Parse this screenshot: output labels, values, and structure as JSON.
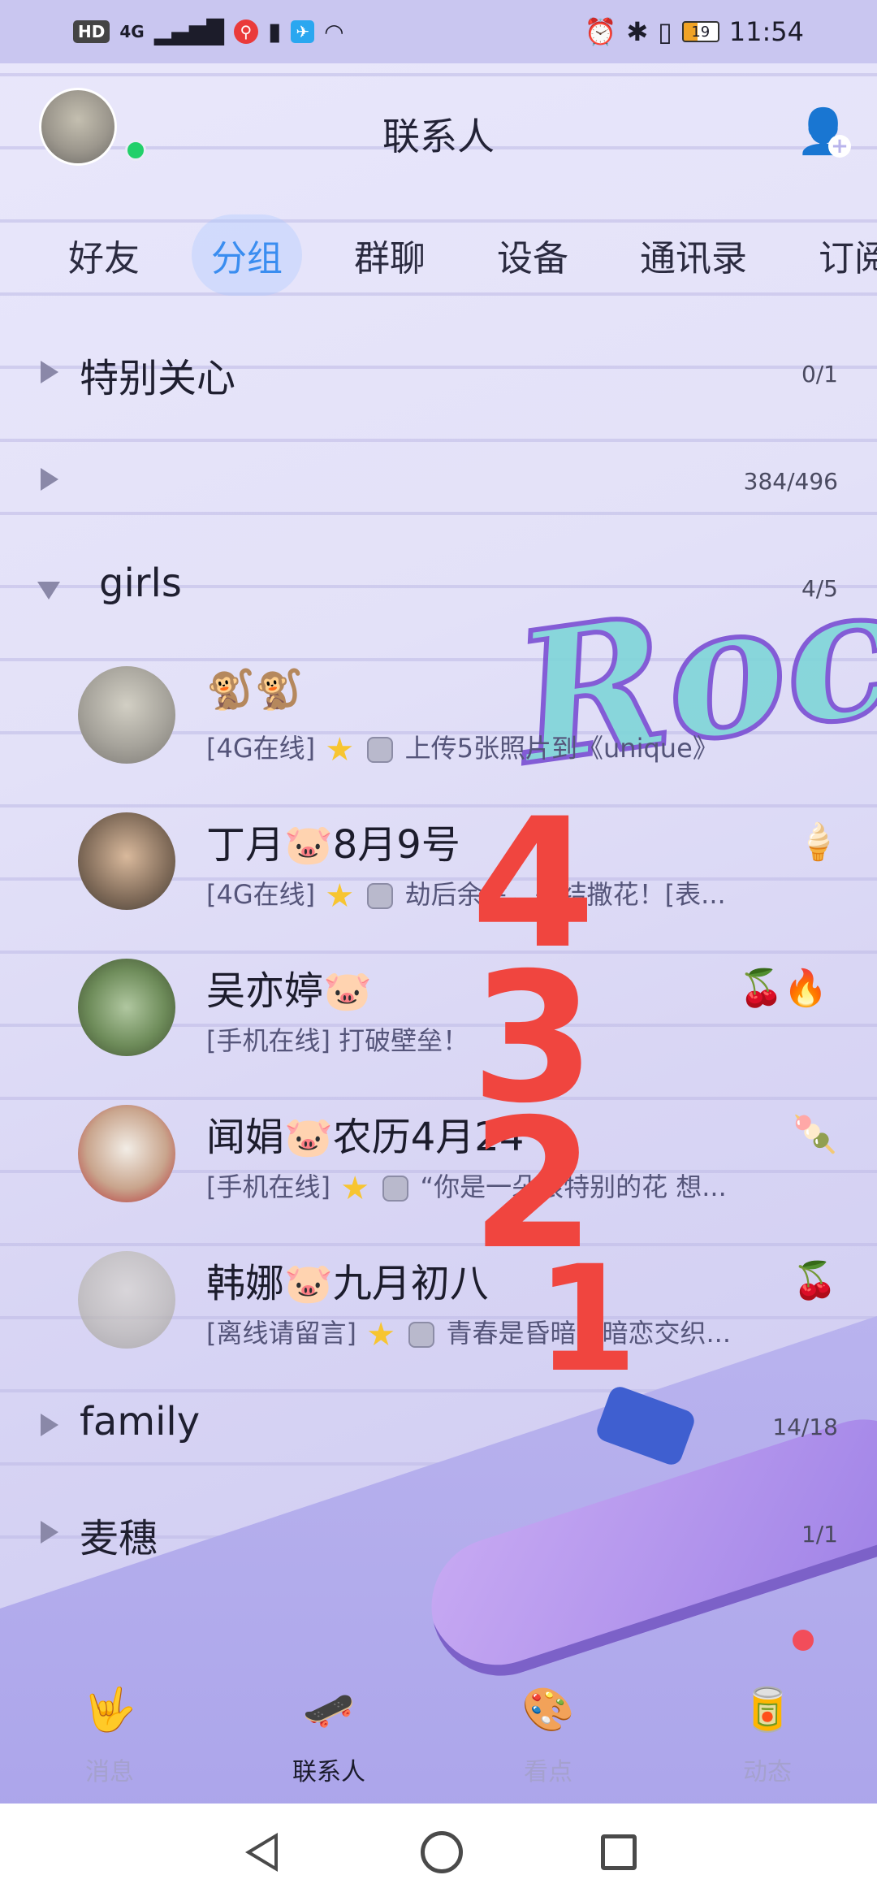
{
  "status_bar": {
    "hd": "HD",
    "network": "4G",
    "battery_level": "19",
    "time": "11:54"
  },
  "header": {
    "title": "联系人"
  },
  "tabs": [
    {
      "label": "好友",
      "active": false
    },
    {
      "label": "分组",
      "active": true
    },
    {
      "label": "群聊",
      "active": false
    },
    {
      "label": "设备",
      "active": false
    },
    {
      "label": "通讯录",
      "active": false
    },
    {
      "label": "订阅",
      "active": false
    }
  ],
  "groups": {
    "special": {
      "name": "特别关心",
      "count": "0/1"
    },
    "unnamed": {
      "name": "",
      "count": "384/496"
    },
    "girls": {
      "name": "girls",
      "count": "4/5"
    },
    "family": {
      "name": "family",
      "count": "14/18"
    },
    "maisui": {
      "name": "麦穗",
      "count": "1/1"
    }
  },
  "contacts": [
    {
      "name": "🐒🐒",
      "status": "[4G在线]",
      "message": "上传5张照片到《unique》",
      "badge": ""
    },
    {
      "name": "丁月🐷8月9号",
      "status": "[4G在线]",
      "message": "劫后余生，完结撒花！[表...",
      "badge": "🍦"
    },
    {
      "name": "吴亦婷🐷",
      "status": "[手机在线]",
      "message": "打破壁垒！",
      "badge": "🍒🔥"
    },
    {
      "name": "闻娟🐷农历4月24",
      "status": "[手机在线]",
      "message": "“你是一朵很特别的花 想...",
      "badge": "🍡"
    },
    {
      "name": "韩娜🐷九月初八",
      "status": "[离线请留言]",
      "message": "青春是昏暗与暗恋交织...",
      "badge": "🍒"
    }
  ],
  "scribbles": [
    "4",
    "3",
    "2",
    "1"
  ],
  "bottom_nav": [
    {
      "label": "消息",
      "icon": "hand-icon"
    },
    {
      "label": "联系人",
      "icon": "skateboard-icon"
    },
    {
      "label": "看点",
      "icon": "spray-icon"
    },
    {
      "label": "动态",
      "icon": "can-icon"
    }
  ]
}
